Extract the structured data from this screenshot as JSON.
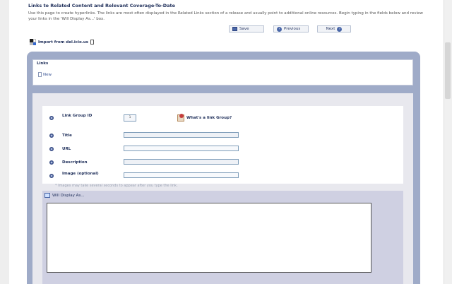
{
  "page": {
    "title": "Links to Related Content and Relevant Coverage-To-Date",
    "intro": "Use this page to create hyperlinks. The links are most often displayed in the Related Links section of a release and usually point to additional online resources. Begin typing in the fields below and review your links in the 'Will Display As...' box."
  },
  "toolbar": {
    "save_label": "Save",
    "previous_label": "Previous",
    "next_label": "Next"
  },
  "import": {
    "label": "Import from del.icio.us"
  },
  "links": {
    "title": "Links",
    "new_label": "New"
  },
  "form": {
    "link_group_label": "Link Group ID",
    "link_group_value": "1",
    "whats_link_group": "What's a link Group?",
    "title_label": "Title",
    "url_label": "URL",
    "description_label": "Description",
    "image_label": "Image (optional)",
    "image_note": "* Images may take several seconds to appear after you type the link."
  },
  "display": {
    "label": "Will Display As..."
  },
  "colors": {
    "accent": "#1f2f5a",
    "panel": "#9fabc8",
    "display_panel": "#cfd0e2",
    "input_border": "#7f9db9"
  },
  "icons": [
    "save-icon",
    "previous-icon",
    "next-icon",
    "delicious-icon",
    "new-doc-icon",
    "link-group-help-icon",
    "display-icon"
  ]
}
